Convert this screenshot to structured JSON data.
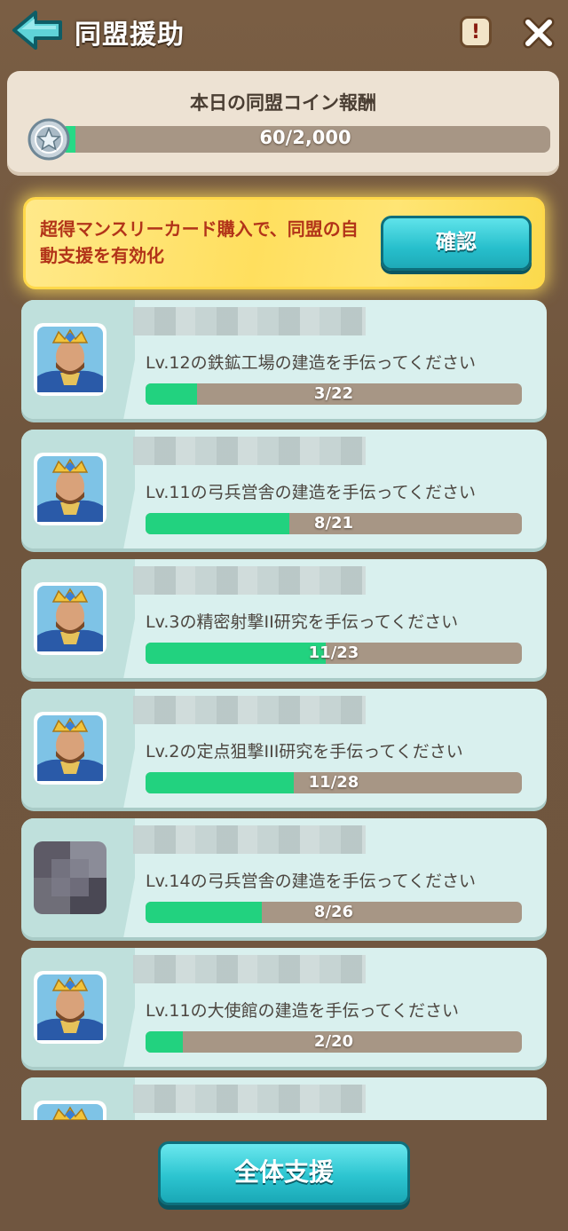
{
  "header": {
    "title": "同盟援助",
    "info_label": "!"
  },
  "coin_panel": {
    "title": "本日の同盟コイン報酬",
    "progress_text": "60/2,000",
    "progress_fraction": 0.03
  },
  "banner": {
    "text": "超得マンスリーカード購入で、同盟の自動支援を有効化",
    "confirm_label": "確認"
  },
  "requests": [
    {
      "text": "Lv.12の鉄鉱工場の建造を手伝ってください",
      "progress_text": "3/22",
      "progress_fraction": 0.136,
      "avatar": "king-avatar"
    },
    {
      "text": "Lv.11の弓兵営舎の建造を手伝ってください",
      "progress_text": "8/21",
      "progress_fraction": 0.381,
      "avatar": "king-avatar"
    },
    {
      "text": "Lv.3の精密射撃II研究を手伝ってください",
      "progress_text": "11/23",
      "progress_fraction": 0.478,
      "avatar": "king-avatar"
    },
    {
      "text": "Lv.2の定点狙撃III研究を手伝ってください",
      "progress_text": "11/28",
      "progress_fraction": 0.393,
      "avatar": "king-avatar"
    },
    {
      "text": "Lv.14の弓兵営舎の建造を手伝ってください",
      "progress_text": "8/26",
      "progress_fraction": 0.308,
      "avatar": "blurred-avatar"
    },
    {
      "text": "Lv.11の大使館の建造を手伝ってください",
      "progress_text": "2/20",
      "progress_fraction": 0.1,
      "avatar": "king-avatar"
    },
    {
      "text": "",
      "progress_text": "",
      "progress_fraction": 0,
      "avatar": "king-avatar"
    }
  ],
  "footer": {
    "assist_all_label": "全体支援"
  },
  "colors": {
    "background": "#74593f",
    "progress_green": "#22d27f",
    "button_teal": "#2cc4d0",
    "banner_yellow": "#ffdf5e",
    "banner_text": "#b23419"
  },
  "icons": {
    "back": "back-arrow-icon",
    "info": "exclamation-icon",
    "close": "close-icon",
    "coin": "alliance-coin-icon"
  }
}
